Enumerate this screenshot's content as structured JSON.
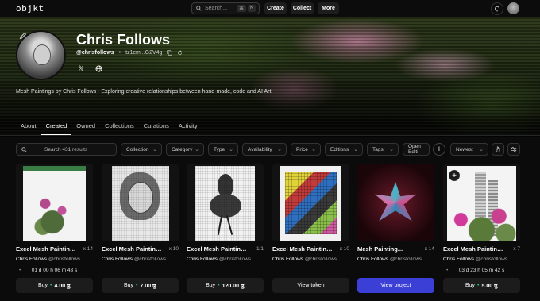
{
  "nav": {
    "logo": "objkt",
    "search_placeholder": "Search...",
    "shortcut_key1": "⌘",
    "shortcut_key2": "K",
    "create": "Create",
    "collect": "Collect",
    "more": "More"
  },
  "profile": {
    "name": "Chris Follows",
    "handle": "@chrisfollows",
    "address": "tz1cm...G2V4g",
    "bio": "Mesh Paintings by Chris Follows -  Exploring creative relationships between hand-made, code and AI Art"
  },
  "tabs": [
    "About",
    "Created",
    "Owned",
    "Collections",
    "Curations",
    "Activity"
  ],
  "active_tab": "Created",
  "filters": {
    "search_placeholder": "Search 431 results",
    "collection": "Collection",
    "category": "Category",
    "type": "Type",
    "availability": "Availability",
    "price": "Price",
    "editions": "Editions",
    "tags": "Tags",
    "open_editions": "Open Editi",
    "sort": "Newest"
  },
  "cards": [
    {
      "title": "Excel Mesh Painting...",
      "editions": "x 14",
      "artist": "Chris Follows",
      "artist_handle": "@chrisfollows",
      "timer": "01 d  00 h  06 m  43 s",
      "button": "Buy",
      "price": "4.00 ꜩ"
    },
    {
      "title": "Excel Mesh Painting...",
      "editions": "x 10",
      "artist": "Chris Follows",
      "artist_handle": "@chrisfollows",
      "timer": "",
      "button": "Buy",
      "price": "7.00 ꜩ"
    },
    {
      "title": "Excel Mesh Painting ...",
      "editions": "1/1",
      "artist": "Chris Follows",
      "artist_handle": "@chrisfollows",
      "timer": "",
      "button": "Buy",
      "price": "120.00 ꜩ"
    },
    {
      "title": "Excel Mesh Painting...",
      "editions": "x 10",
      "artist": "Chris Follows",
      "artist_handle": "@chrisfollows",
      "timer": "",
      "button": "View token",
      "price": ""
    },
    {
      "title": "Mesh Painting...",
      "editions": "x 14",
      "artist": "Chris Follows",
      "artist_handle": "@chrisfollows",
      "timer": "",
      "button": "View project",
      "price": ""
    },
    {
      "title": "Excel Mesh Painting...",
      "editions": "x 7",
      "artist": "Chris Follows",
      "artist_handle": "@chrisfollows",
      "timer": "03 d  23 h  05 m  42 s",
      "button": "Buy",
      "price": "5.00 ꜩ"
    }
  ],
  "colors": {
    "accent_button": "#3b3fd6",
    "price_dot": "#27c46b",
    "background": "#0b0b0b"
  },
  "icons": [
    "search-icon",
    "bell-icon",
    "pencil-icon",
    "x-twitter-icon",
    "globe-icon",
    "copy-icon",
    "refresh-icon",
    "plus-icon",
    "chevron-down-icon",
    "hand-icon",
    "sliders-icon"
  ]
}
